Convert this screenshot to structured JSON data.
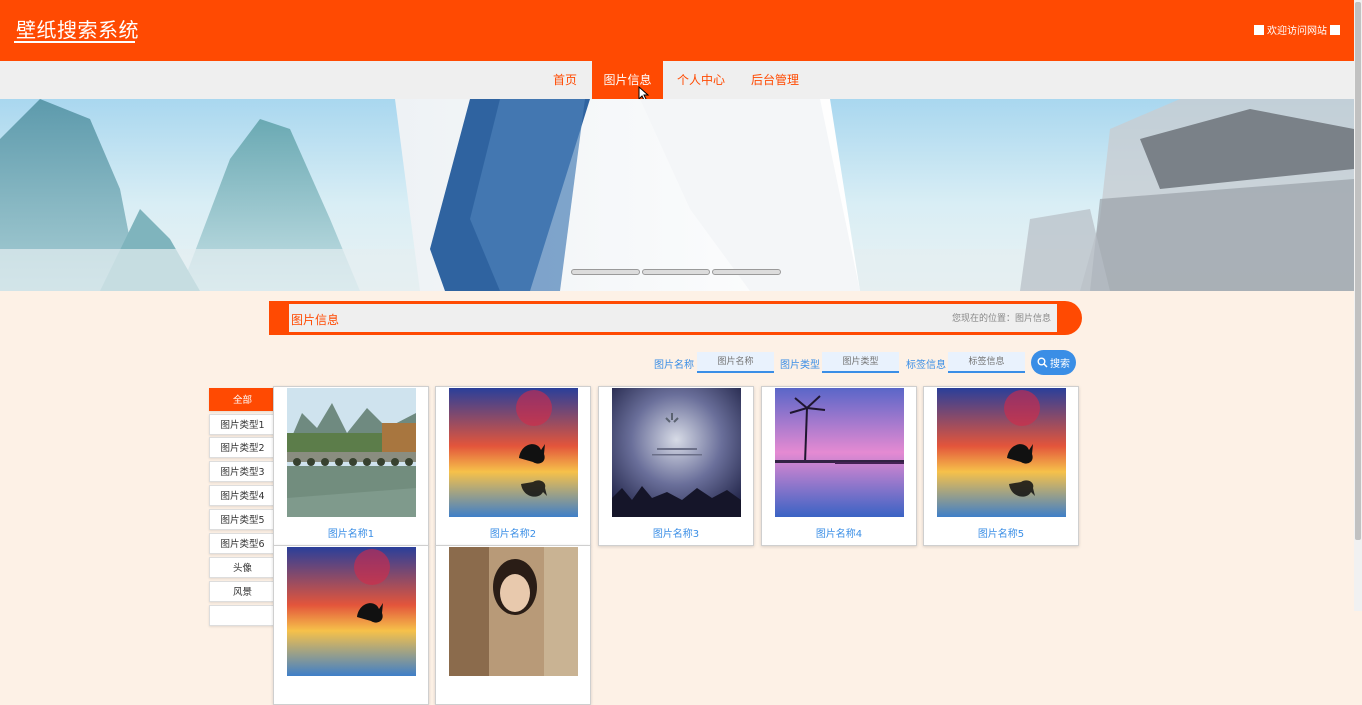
{
  "header": {
    "brand": "壁纸搜索系统",
    "welcome": "欢迎访问网站"
  },
  "nav": {
    "items": [
      "首页",
      "图片信息",
      "个人中心",
      "后台管理"
    ],
    "active": "图片信息"
  },
  "section": {
    "title": "图片信息",
    "breadcrumb": "您现在的位置：图片信息"
  },
  "search": {
    "name_label": "图片名称",
    "name_placeholder": "图片名称",
    "type_label": "图片类型",
    "type_placeholder": "图片类型",
    "tag_label": "标签信息",
    "tag_placeholder": "标签信息",
    "button": "搜索"
  },
  "categories": [
    "全部",
    "图片类型1",
    "图片类型2",
    "图片类型3",
    "图片类型4",
    "图片类型5",
    "图片类型6",
    "头像",
    "风景"
  ],
  "cards": [
    {
      "name": "图片名称1",
      "image": "bridge-landscape"
    },
    {
      "name": "图片名称2",
      "image": "dolphin-sunset"
    },
    {
      "name": "图片名称3",
      "image": "night-sky-text"
    },
    {
      "name": "图片名称4",
      "image": "palm-beach"
    },
    {
      "name": "图片名称5",
      "image": "dolphin-sunset"
    },
    {
      "name": "",
      "image": "dolphin-sunset"
    },
    {
      "name": "",
      "image": "portrait"
    }
  ],
  "colors": {
    "primary": "#ff4a02",
    "accent": "#3a8ee6",
    "background": "#fdf1e6"
  }
}
